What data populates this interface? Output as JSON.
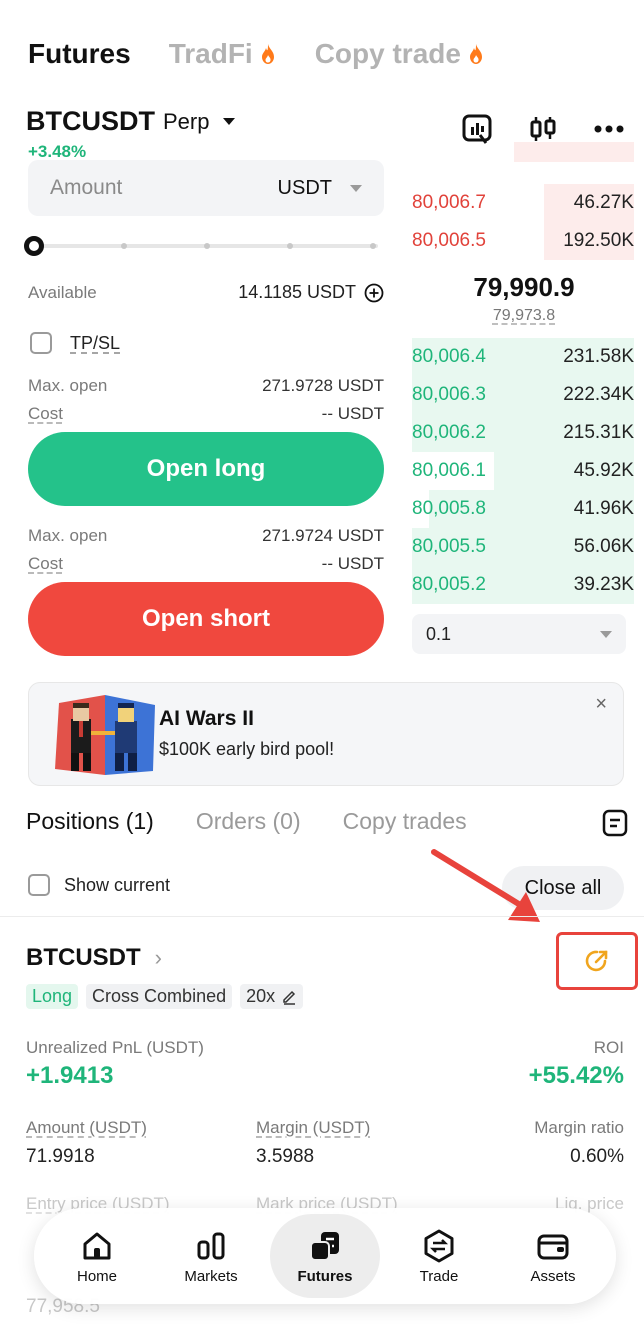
{
  "top_tabs": [
    {
      "label": "Futures",
      "active": true
    },
    {
      "label": "TradFi",
      "active": false,
      "badge": "fire-icon"
    },
    {
      "label": "Copy trade",
      "active": false,
      "badge": "fire-icon"
    }
  ],
  "pair": {
    "name": "BTCUSDT",
    "type": "Perp",
    "change": "+3.48%"
  },
  "order_form": {
    "amount_placeholder": "Amount",
    "amount_unit": "USDT",
    "available_label": "Available",
    "available_value": "14.1185 USDT",
    "tpsl_label": "TP/SL",
    "long": {
      "max_open_label": "Max. open",
      "max_open_value": "271.9728 USDT",
      "cost_label": "Cost",
      "cost_value": "-- USDT",
      "button": "Open long"
    },
    "short": {
      "max_open_label": "Max. open",
      "max_open_value": "271.9724 USDT",
      "cost_label": "Cost",
      "cost_value": "-- USDT",
      "button": "Open short"
    }
  },
  "order_book": {
    "asks": [
      {
        "price": "80,006.7",
        "qty": "46.27K"
      },
      {
        "price": "80,006.5",
        "qty": "192.50K"
      }
    ],
    "last_price": "79,990.9",
    "mark_price": "79,973.8",
    "bids": [
      {
        "price": "80,006.4",
        "qty": "231.58K"
      },
      {
        "price": "80,006.3",
        "qty": "222.34K"
      },
      {
        "price": "80,006.2",
        "qty": "215.31K"
      },
      {
        "price": "80,006.1",
        "qty": "45.92K"
      },
      {
        "price": "80,005.8",
        "qty": "41.96K"
      },
      {
        "price": "80,005.5",
        "qty": "56.06K"
      },
      {
        "price": "80,005.2",
        "qty": "39.23K"
      }
    ],
    "depth_step": "0.1"
  },
  "banner": {
    "title": "AI Wars II",
    "subtitle": "$100K early bird pool!",
    "close": "×"
  },
  "positions_tabs": [
    {
      "label": "Positions (1)",
      "active": true
    },
    {
      "label": "Orders (0)",
      "active": false
    },
    {
      "label": "Copy trades",
      "active": false
    }
  ],
  "show_current_label": "Show current",
  "close_all_label": "Close all",
  "position": {
    "symbol": "BTCUSDT",
    "tags": [
      "Long",
      "Cross Combined",
      "20x"
    ],
    "unrealized_pnl_label": "Unrealized PnL (USDT)",
    "unrealized_pnl": "+1.9413",
    "roi_label": "ROI",
    "roi": "+55.42%",
    "amount_label": "Amount (USDT)",
    "amount": "71.9918",
    "margin_label": "Margin (USDT)",
    "margin": "3.5988",
    "margin_ratio_label": "Margin ratio",
    "margin_ratio": "0.60%",
    "entry_price_label": "Entry price (USDT)",
    "mark_price_label": "Mark price (USDT)",
    "liq_price_label": "Liq. price",
    "be_price": "77,958.5"
  },
  "bottom_nav": [
    {
      "label": "Home",
      "icon": "home-icon",
      "active": false
    },
    {
      "label": "Markets",
      "icon": "markets-icon",
      "active": false
    },
    {
      "label": "Futures",
      "icon": "futures-icon",
      "active": true
    },
    {
      "label": "Trade",
      "icon": "trade-icon",
      "active": false
    },
    {
      "label": "Assets",
      "icon": "wallet-icon",
      "active": false
    }
  ],
  "colors": {
    "green": "#1fb57a",
    "red": "#f0483e",
    "highlight": "#e8433c"
  }
}
